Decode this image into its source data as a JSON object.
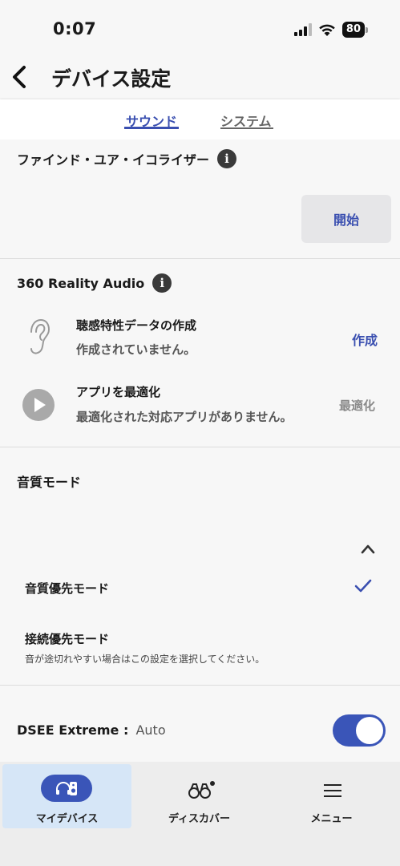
{
  "status": {
    "time": "0:07",
    "battery": "80"
  },
  "header": {
    "title": "デバイス設定"
  },
  "tabs": [
    {
      "label": "サウンド",
      "active": true
    },
    {
      "label": "システム",
      "active": false
    }
  ],
  "equalizer": {
    "title": "ファインド・ユア・イコライザー",
    "start_label": "開始"
  },
  "reality_audio": {
    "title": "360 Reality Audio",
    "rows": [
      {
        "title": "聴感特性データの作成",
        "subtitle": "作成されていません。",
        "action": "作成",
        "icon": "ear-icon"
      },
      {
        "title": "アプリを最適化",
        "subtitle": "最適化された対応アプリがありません。",
        "action": "最適化",
        "icon": "play-icon"
      }
    ]
  },
  "sound_mode": {
    "title": "音質モード",
    "options": [
      {
        "label": "音質優先モード",
        "selected": true
      },
      {
        "label": "接続優先モード",
        "description": "音が途切れやすい場合はこの設定を選択してください。",
        "selected": false
      }
    ]
  },
  "dsee": {
    "label": "DSEE Extreme :",
    "value": "Auto",
    "enabled": true
  },
  "bottom_nav": [
    {
      "label": "マイデバイス",
      "icon": "headphones-speaker-icon",
      "active": true
    },
    {
      "label": "ディスカバー",
      "icon": "binoculars-icon",
      "active": false
    },
    {
      "label": "メニュー",
      "icon": "menu-icon",
      "active": false
    }
  ],
  "colors": {
    "accent": "#3a55b8",
    "link": "#3a4fb0",
    "active_nav": "#d6e6f7"
  }
}
